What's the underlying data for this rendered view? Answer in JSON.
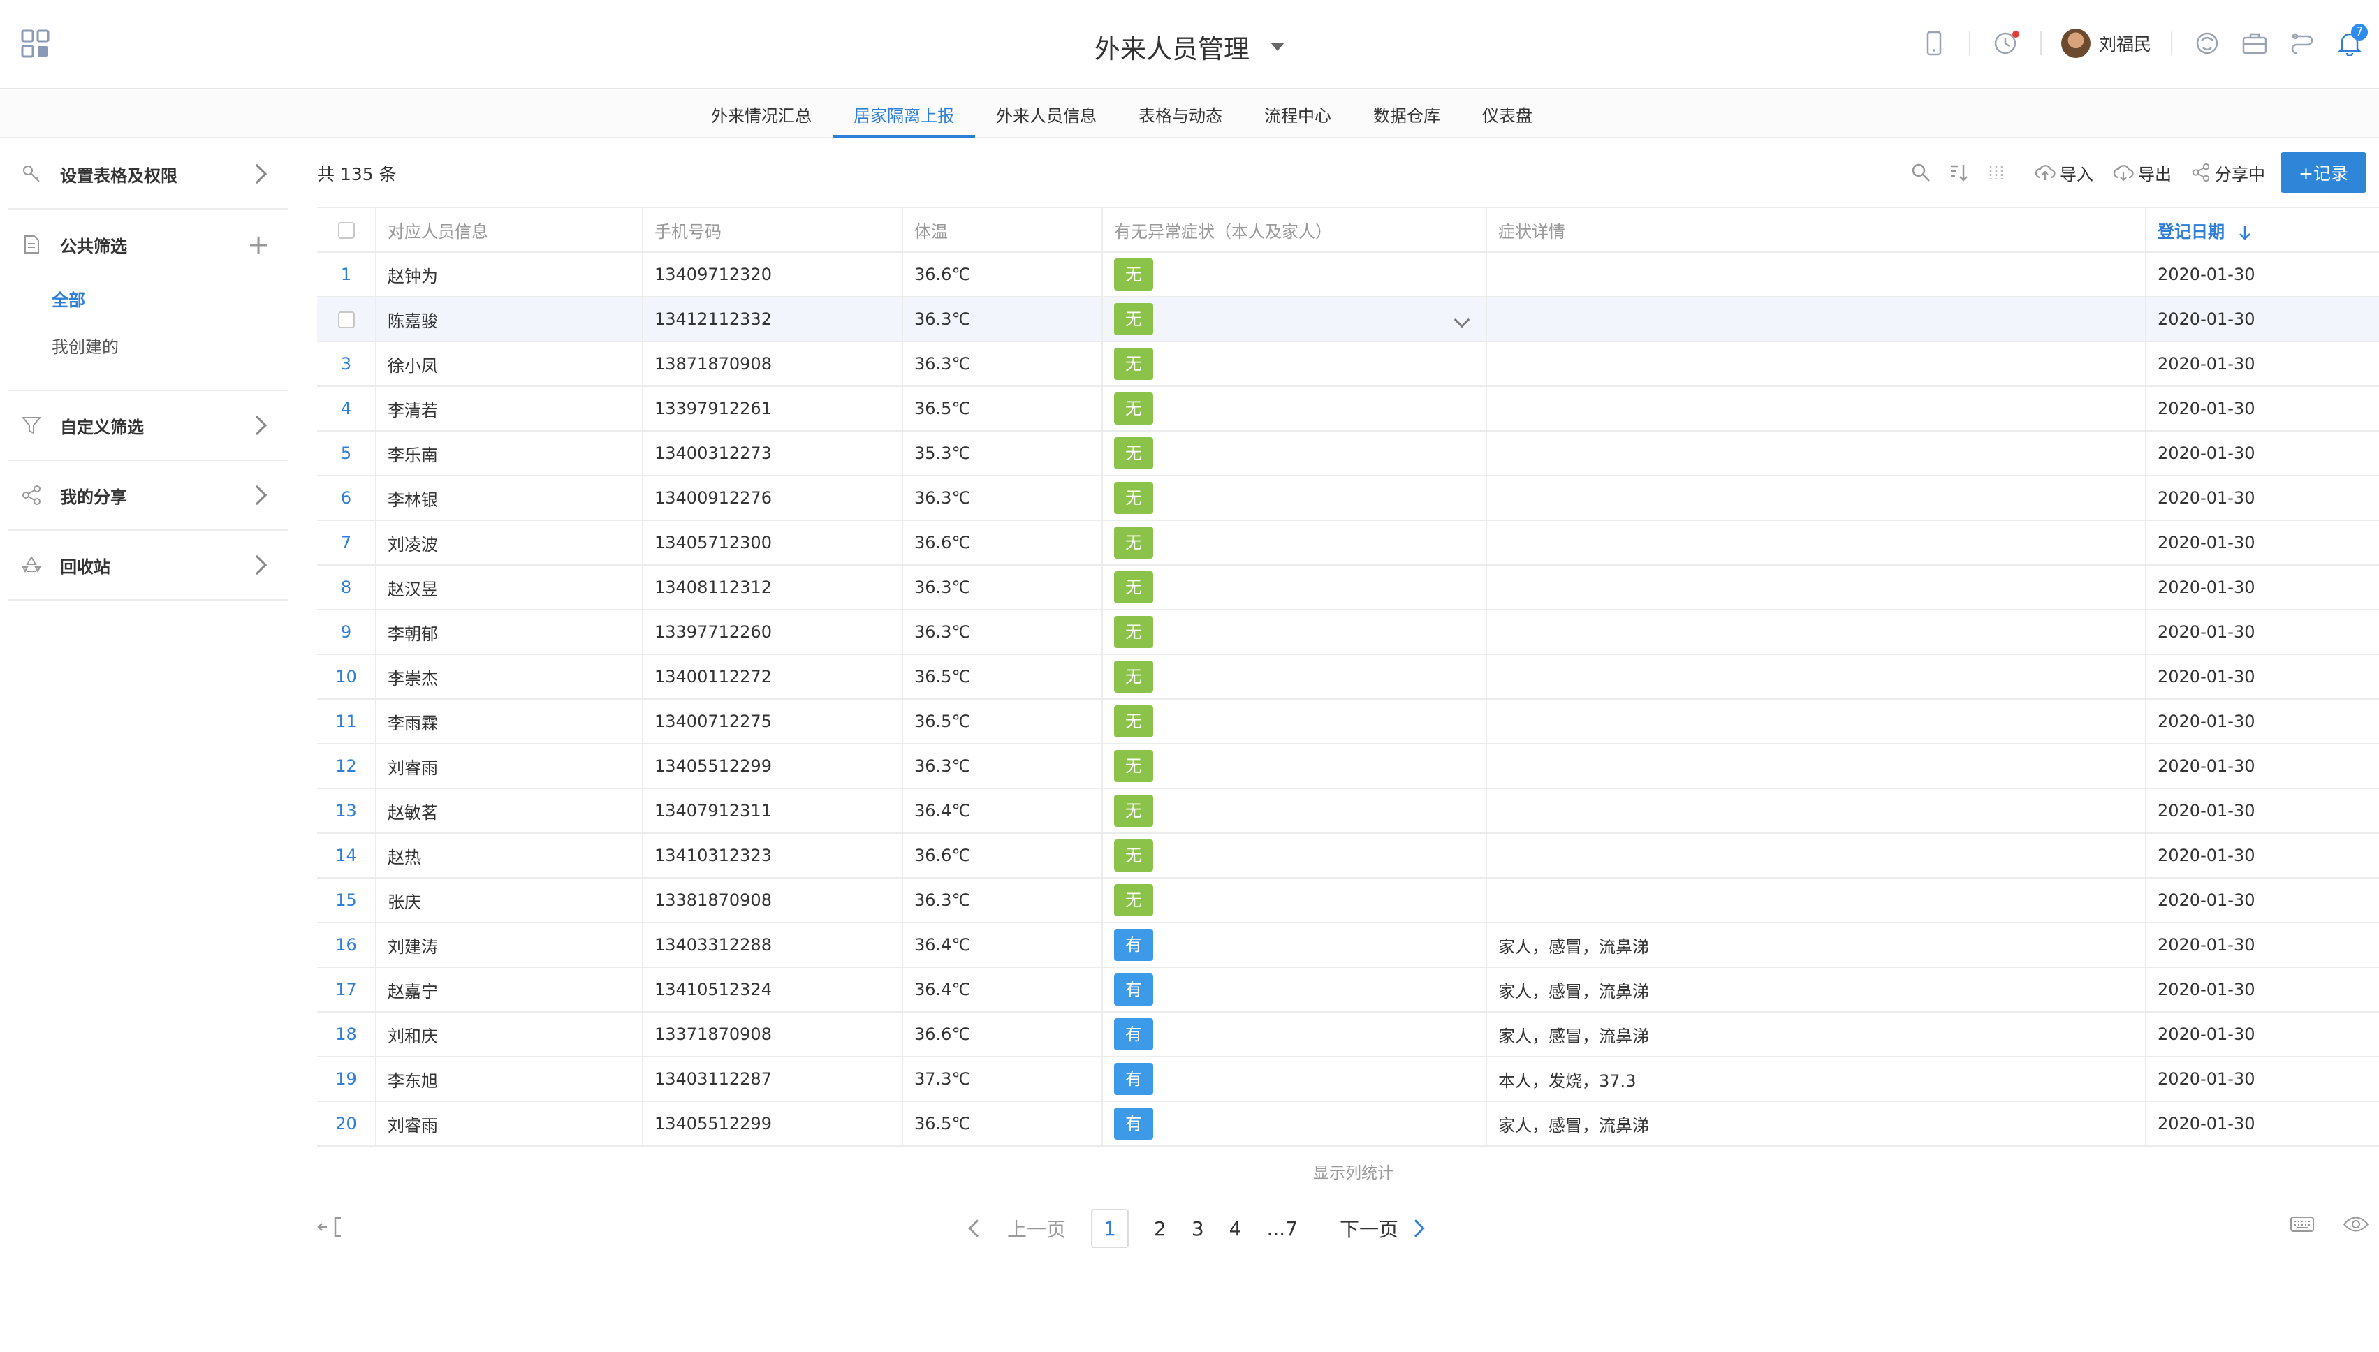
{
  "app": {
    "title": "外来人员管理"
  },
  "header": {
    "user_name": "刘福民",
    "notification_count": "7"
  },
  "nav": {
    "tabs": [
      {
        "label": "外来情况汇总",
        "active": false
      },
      {
        "label": "居家隔离上报",
        "active": true
      },
      {
        "label": "外来人员信息",
        "active": false
      },
      {
        "label": "表格与动态",
        "active": false
      },
      {
        "label": "流程中心",
        "active": false
      },
      {
        "label": "数据仓库",
        "active": false
      },
      {
        "label": "仪表盘",
        "active": false
      }
    ]
  },
  "sidebar": {
    "settings_label": "设置表格及权限",
    "public_filter_label": "公共筛选",
    "filter_items": [
      {
        "label": "全部",
        "active": true
      },
      {
        "label": "我创建的",
        "active": false
      }
    ],
    "custom_filter_label": "自定义筛选",
    "my_share_label": "我的分享",
    "recycle_label": "回收站"
  },
  "main": {
    "count_text": "共 135 条",
    "toolbar": {
      "import_label": "导入",
      "export_label": "导出",
      "share_label": "分享中",
      "add_label": "+记录"
    },
    "columns": [
      "对应人员信息",
      "手机号码",
      "体温",
      "有无异常症状（本人及家人）",
      "症状详情",
      "登记日期"
    ],
    "rows": [
      {
        "no": "1",
        "name": "赵钟为",
        "phone": "13409712320",
        "temp": "36.6℃",
        "symptom": "无",
        "detail": "",
        "date": "2020-01-30"
      },
      {
        "no": "",
        "name": "陈嘉骏",
        "phone": "13412112332",
        "temp": "36.3℃",
        "symptom": "无",
        "detail": "",
        "date": "2020-01-30"
      },
      {
        "no": "3",
        "name": "徐小凤",
        "phone": "13871870908",
        "temp": "36.3℃",
        "symptom": "无",
        "detail": "",
        "date": "2020-01-30"
      },
      {
        "no": "4",
        "name": "李清若",
        "phone": "13397912261",
        "temp": "36.5℃",
        "symptom": "无",
        "detail": "",
        "date": "2020-01-30"
      },
      {
        "no": "5",
        "name": "李乐南",
        "phone": "13400312273",
        "temp": "35.3℃",
        "symptom": "无",
        "detail": "",
        "date": "2020-01-30"
      },
      {
        "no": "6",
        "name": "李林银",
        "phone": "13400912276",
        "temp": "36.3℃",
        "symptom": "无",
        "detail": "",
        "date": "2020-01-30"
      },
      {
        "no": "7",
        "name": "刘凌波",
        "phone": "13405712300",
        "temp": "36.6℃",
        "symptom": "无",
        "detail": "",
        "date": "2020-01-30"
      },
      {
        "no": "8",
        "name": "赵汉昱",
        "phone": "13408112312",
        "temp": "36.3℃",
        "symptom": "无",
        "detail": "",
        "date": "2020-01-30"
      },
      {
        "no": "9",
        "name": "李朝郁",
        "phone": "13397712260",
        "temp": "36.3℃",
        "symptom": "无",
        "detail": "",
        "date": "2020-01-30"
      },
      {
        "no": "10",
        "name": "李崇杰",
        "phone": "13400112272",
        "temp": "36.5℃",
        "symptom": "无",
        "detail": "",
        "date": "2020-01-30"
      },
      {
        "no": "11",
        "name": "李雨霖",
        "phone": "13400712275",
        "temp": "36.5℃",
        "symptom": "无",
        "detail": "",
        "date": "2020-01-30"
      },
      {
        "no": "12",
        "name": "刘睿雨",
        "phone": "13405512299",
        "temp": "36.3℃",
        "symptom": "无",
        "detail": "",
        "date": "2020-01-30"
      },
      {
        "no": "13",
        "name": "赵敏茗",
        "phone": "13407912311",
        "temp": "36.4℃",
        "symptom": "无",
        "detail": "",
        "date": "2020-01-30"
      },
      {
        "no": "14",
        "name": "赵热",
        "phone": "13410312323",
        "temp": "36.6℃",
        "symptom": "无",
        "detail": "",
        "date": "2020-01-30"
      },
      {
        "no": "15",
        "name": "张庆",
        "phone": "13381870908",
        "temp": "36.3℃",
        "symptom": "无",
        "detail": "",
        "date": "2020-01-30"
      },
      {
        "no": "16",
        "name": "刘建涛",
        "phone": "13403312288",
        "temp": "36.4℃",
        "symptom": "有",
        "detail": "家人，感冒，流鼻涕",
        "date": "2020-01-30"
      },
      {
        "no": "17",
        "name": "赵嘉宁",
        "phone": "13410512324",
        "temp": "36.4℃",
        "symptom": "有",
        "detail": "家人，感冒，流鼻涕",
        "date": "2020-01-30"
      },
      {
        "no": "18",
        "name": "刘和庆",
        "phone": "13371870908",
        "temp": "36.6℃",
        "symptom": "有",
        "detail": "家人，感冒，流鼻涕",
        "date": "2020-01-30"
      },
      {
        "no": "19",
        "name": "李东旭",
        "phone": "13403112287",
        "temp": "37.3℃",
        "symptom": "有",
        "detail": "本人，发烧，37.3",
        "date": "2020-01-30"
      },
      {
        "no": "20",
        "name": "刘睿雨",
        "phone": "13405512299",
        "temp": "36.5℃",
        "symptom": "有",
        "detail": "家人，感冒，流鼻涕",
        "date": "2020-01-30"
      }
    ],
    "column_stats_label": "显示列统计"
  },
  "pager": {
    "prev_label": "上一页",
    "next_label": "下一页",
    "pages": [
      "1",
      "2",
      "3",
      "4",
      "...7"
    ],
    "current": "1"
  },
  "colors": {
    "accent": "#2f7fd8",
    "tag_no": "#8bc34a",
    "tag_yes": "#3d9ae8",
    "notify_dot": "#e53935"
  }
}
